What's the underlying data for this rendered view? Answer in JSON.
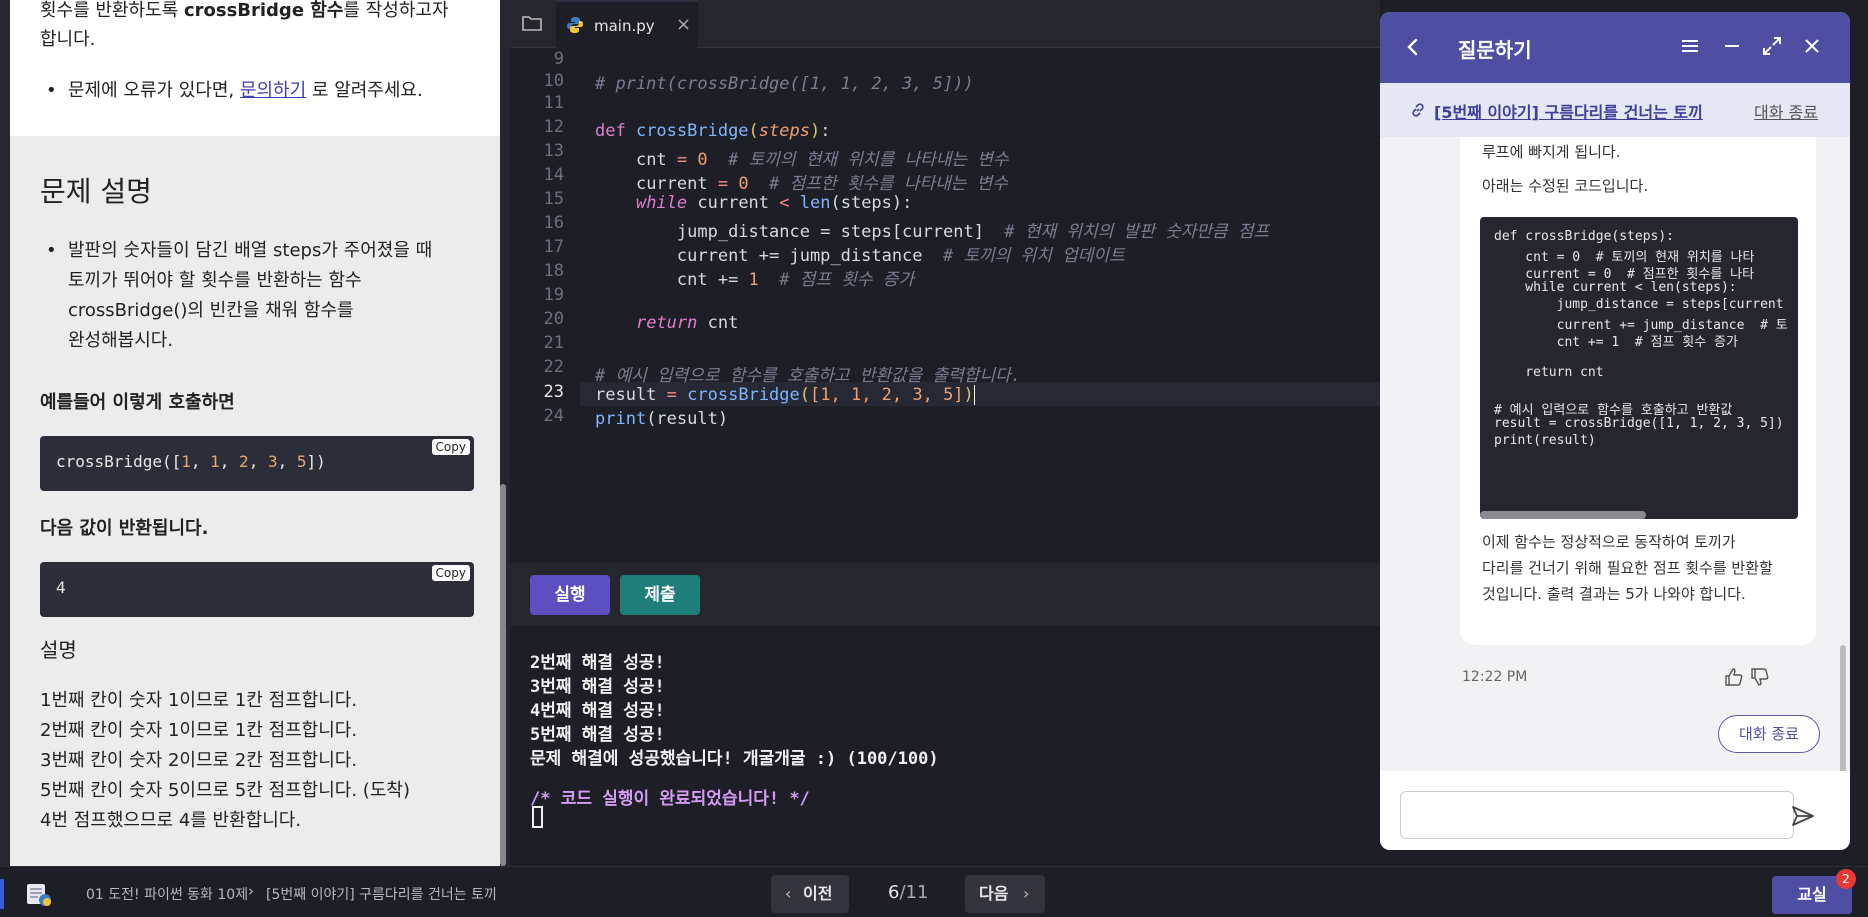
{
  "problem": {
    "top_text_pre": "횟수를 반환하도록 ",
    "top_text_bold": "crossBridge 함수",
    "top_text_post": "를 작성하고자",
    "top_text_line2": "합니다.",
    "error_pre": "문제에 오류가 있다면, ",
    "error_link": "문의하기",
    "error_post": " 로 알려주세요.",
    "section_title": "문제 설명",
    "desc_bullet_lines": [
      "발판의 숫자들이 담긴 배열 steps가 주어졌을 때",
      "토끼가 뛰어야 할 횟수를 반환하는 함수",
      "crossBridge()의 빈칸을 채워 함수를",
      "완성해봅시다."
    ],
    "example_heading": "예를들어 이렇게 호출하면",
    "example_code_fn": "crossBridge([",
    "example_code_nums": [
      "1",
      "1",
      "2",
      "3",
      "5"
    ],
    "example_code_end": "])",
    "copy_label": "Copy",
    "returns_heading": "다음 값이 반환됩니다.",
    "returns_value": "4",
    "explain_heading": "설명",
    "explain_lines": [
      "1번째 칸이 숫자 1이므로 1칸 점프합니다.",
      "2번째 칸이 숫자 1이므로 1칸 점프합니다.",
      "3번째 칸이 숫자 2이므로 2칸 점프합니다.",
      "5번째 칸이 숫자 5이므로 5칸 점프합니다. (도착)",
      "4번 점프했으므로 4를 반환합니다."
    ]
  },
  "editor": {
    "tab_name": "main.py",
    "tab_close": "×",
    "line_numbers": [
      "9",
      "10",
      "11",
      "12",
      "13",
      "14",
      "15",
      "16",
      "17",
      "18",
      "19",
      "20",
      "21",
      "22",
      "23",
      "24"
    ],
    "active_line": "23",
    "code": {
      "l10": "# print(crossBridge([1, 1, 2, 3, 5]))",
      "l12_def": "def ",
      "l12_fn": "crossBridge",
      "l12_param": "steps",
      "l13_var": "cnt",
      "l13_num": "0",
      "l13_cmt": "# 토끼의 현재 위치를 나타내는 변수",
      "l14_var": "current",
      "l14_num": "0",
      "l14_cmt": "# 점프한 횟수를 나타내는 변수",
      "l15_kw": "while",
      "l15_rest": " current ",
      "l15_op": "<",
      "l15_fn": "len",
      "l15_arg": "(steps):",
      "l16_code": "jump_distance = steps[current]",
      "l16_cmt": "# 현재 위치의 발판 숫자만큼 점프",
      "l17_code": "current += jump_distance",
      "l17_cmt": "# 토끼의 위치 업데이트",
      "l18_code": "cnt += ",
      "l18_num": "1",
      "l18_cmt": "# 점프 횟수 증가",
      "l20_kw": "return",
      "l20_rest": " cnt",
      "l22_cmt": "# 예시 입력으로 함수를 호출하고 반환값을 출력합니다.",
      "l23_var": "result",
      "l23_fn": "crossBridge",
      "l23_args": "[1, 1, 2, 3, 5]",
      "l24_fn": "print",
      "l24_arg": "(result)"
    }
  },
  "runbar": {
    "run_label": "실행",
    "submit_label": "제출"
  },
  "terminal": {
    "lines": [
      "2번째 해결 성공!",
      "3번째 해결 성공!",
      "4번째 해결 성공!",
      "5번째 해결 성공!",
      "문제 해결에 성공했습니다! 개굴개굴 :) (100/100)"
    ],
    "done_line": "/* 코드 실행이 완료되었습니다! */"
  },
  "chat": {
    "title": "질문하기",
    "sub_link": "[5번째 이야기] 구름다리를 건너는 토끼",
    "sub_end": "대화 종료",
    "msg_top": "루프에 빠지게 됩니다.",
    "msg_intro": "아래는 수정된 코드입니다.",
    "code_lines": [
      "def crossBridge(steps):",
      "    cnt = 0  # 토끼의 현재 위치를 나타",
      "    current = 0  # 점프한 횟수를 나타",
      "    while current < len(steps):",
      "        jump_distance = steps[current",
      "        current += jump_distance  # 토",
      "        cnt += 1  # 점프 횟수 증가",
      "",
      "    return cnt",
      "",
      "# 예시 입력으로 함수를 호출하고 반환값",
      "result = crossBridge([1, 1, 2, 3, 5])",
      "print(result)"
    ],
    "msg_outro": [
      "이제 함수는 정상적으로 동작하여 토끼가",
      "다리를 건너기 위해 필요한 점프 횟수를 반환할",
      "것입니다. 출력 결과는 5가 나와야 합니다."
    ],
    "time": "12:22 PM",
    "end_button": "대화 종료",
    "input_value": "",
    "input_placeholder": ""
  },
  "bottom": {
    "crumb1": "01 도전! 파이썬 동화 10제",
    "crumb_sep": "›",
    "crumb2": "[5번째 이야기] 구름다리를 건너는 토끼",
    "prev_label": "이전",
    "next_label": "다음",
    "page_current": "6",
    "page_total": "/11",
    "classroom_label": "교실",
    "badge_count": "2"
  },
  "colors": {
    "run_button": "#5b4fc2",
    "submit_button": "#1f7e79",
    "chat_header": "#4e4fa3",
    "badge": "#e53935"
  },
  "icons": [
    "folder-icon",
    "python-icon",
    "back-icon",
    "menu-icon",
    "minimize-icon",
    "expand-icon",
    "close-icon",
    "link-icon",
    "thumbs-up-icon",
    "thumbs-down-icon",
    "send-icon",
    "course-icon",
    "chevron-left-icon",
    "chevron-right-icon"
  ]
}
